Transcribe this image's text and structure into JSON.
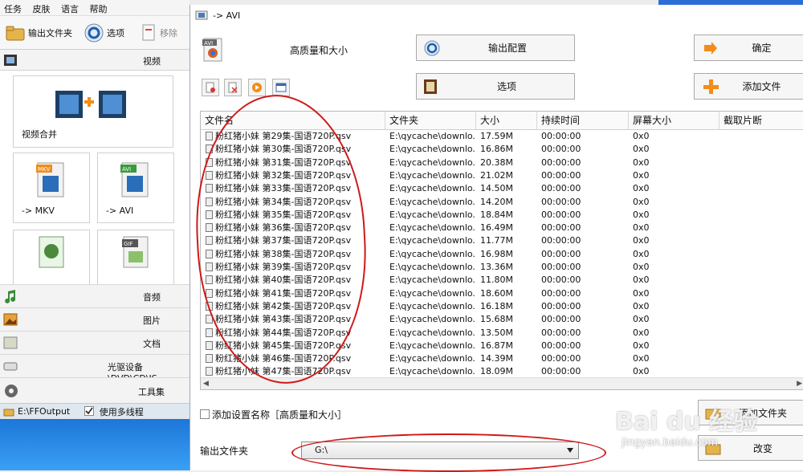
{
  "main_app": {
    "menu": [
      "任务",
      "皮肤",
      "语言",
      "帮助"
    ],
    "toolbar": {
      "output_folder": "输出文件夹",
      "options": "选项",
      "remove": "移除"
    },
    "categories": {
      "video": "视频",
      "audio": "音频",
      "image": "图片",
      "document": "文档",
      "disc": "光驱设备\\DVD\\CD\\IS",
      "tools": "工具集"
    },
    "tiles": {
      "merge": "视频合并",
      "mkv": "-> MKV",
      "avi": "-> AVI",
      "mkv_badge": "MKV",
      "avi_badge": "AVI",
      "gif_badge": "GIF"
    },
    "statusbar": {
      "path": "E:\\FFOutput",
      "multithread": "使用多线程"
    }
  },
  "dialog": {
    "title": "-> AVI",
    "format_badge": "AVI",
    "quality": "高质量和大小",
    "buttons": {
      "output_config": "输出配置",
      "options": "选项",
      "ok": "确定",
      "add_file": "添加文件",
      "add_folder": "添加文件夹",
      "change": "改变"
    },
    "table": {
      "columns": [
        "文件名",
        "文件夹",
        "大小",
        "持续时间",
        "屏幕大小",
        "截取片断"
      ],
      "rows": [
        [
          "粉红猪小妹 第29集-国语720P.qsv",
          "E:\\qycache\\downlo...",
          "17.59M",
          "00:00:00",
          "0x0"
        ],
        [
          "粉红猪小妹 第30集-国语720P.qsv",
          "E:\\qycache\\downlo...",
          "16.86M",
          "00:00:00",
          "0x0"
        ],
        [
          "粉红猪小妹 第31集-国语720P.qsv",
          "E:\\qycache\\downlo...",
          "20.38M",
          "00:00:00",
          "0x0"
        ],
        [
          "粉红猪小妹 第32集-国语720P.qsv",
          "E:\\qycache\\downlo...",
          "21.02M",
          "00:00:00",
          "0x0"
        ],
        [
          "粉红猪小妹 第33集-国语720P.qsv",
          "E:\\qycache\\downlo...",
          "14.50M",
          "00:00:00",
          "0x0"
        ],
        [
          "粉红猪小妹 第34集-国语720P.qsv",
          "E:\\qycache\\downlo...",
          "14.20M",
          "00:00:00",
          "0x0"
        ],
        [
          "粉红猪小妹 第35集-国语720P.qsv",
          "E:\\qycache\\downlo...",
          "18.84M",
          "00:00:00",
          "0x0"
        ],
        [
          "粉红猪小妹 第36集-国语720P.qsv",
          "E:\\qycache\\downlo...",
          "16.49M",
          "00:00:00",
          "0x0"
        ],
        [
          "粉红猪小妹 第37集-国语720P.qsv",
          "E:\\qycache\\downlo...",
          "11.77M",
          "00:00:00",
          "0x0"
        ],
        [
          "粉红猪小妹 第38集-国语720P.qsv",
          "E:\\qycache\\downlo...",
          "16.98M",
          "00:00:00",
          "0x0"
        ],
        [
          "粉红猪小妹 第39集-国语720P.qsv",
          "E:\\qycache\\downlo...",
          "13.36M",
          "00:00:00",
          "0x0"
        ],
        [
          "粉红猪小妹 第40集-国语720P.qsv",
          "E:\\qycache\\downlo...",
          "11.80M",
          "00:00:00",
          "0x0"
        ],
        [
          "粉红猪小妹 第41集-国语720P.qsv",
          "E:\\qycache\\downlo...",
          "18.60M",
          "00:00:00",
          "0x0"
        ],
        [
          "粉红猪小妹 第42集-国语720P.qsv",
          "E:\\qycache\\downlo...",
          "16.18M",
          "00:00:00",
          "0x0"
        ],
        [
          "粉红猪小妹 第43集-国语720P.qsv",
          "E:\\qycache\\downlo...",
          "15.68M",
          "00:00:00",
          "0x0"
        ],
        [
          "粉红猪小妹 第44集-国语720P.qsv",
          "E:\\qycache\\downlo...",
          "13.50M",
          "00:00:00",
          "0x0"
        ],
        [
          "粉红猪小妹 第45集-国语720P.qsv",
          "E:\\qycache\\downlo...",
          "16.87M",
          "00:00:00",
          "0x0"
        ],
        [
          "粉红猪小妹 第46集-国语720P.qsv",
          "E:\\qycache\\downlo...",
          "14.39M",
          "00:00:00",
          "0x0"
        ],
        [
          "粉红猪小妹 第47集-国语720P.qsv",
          "E:\\qycache\\downlo...",
          "18.09M",
          "00:00:00",
          "0x0"
        ]
      ]
    },
    "add_setting_name": "添加设置名称［高质量和大小］",
    "output_folder_label": "输出文件夹",
    "output_folder_value": "G:\\"
  },
  "watermark": {
    "brand": "Bai du 经验",
    "url": "jingyan.baidu.com"
  },
  "colors": {
    "annotation_red": "#d01818",
    "accent_orange": "#f28c1a",
    "film_blue": "#2a6db8"
  }
}
